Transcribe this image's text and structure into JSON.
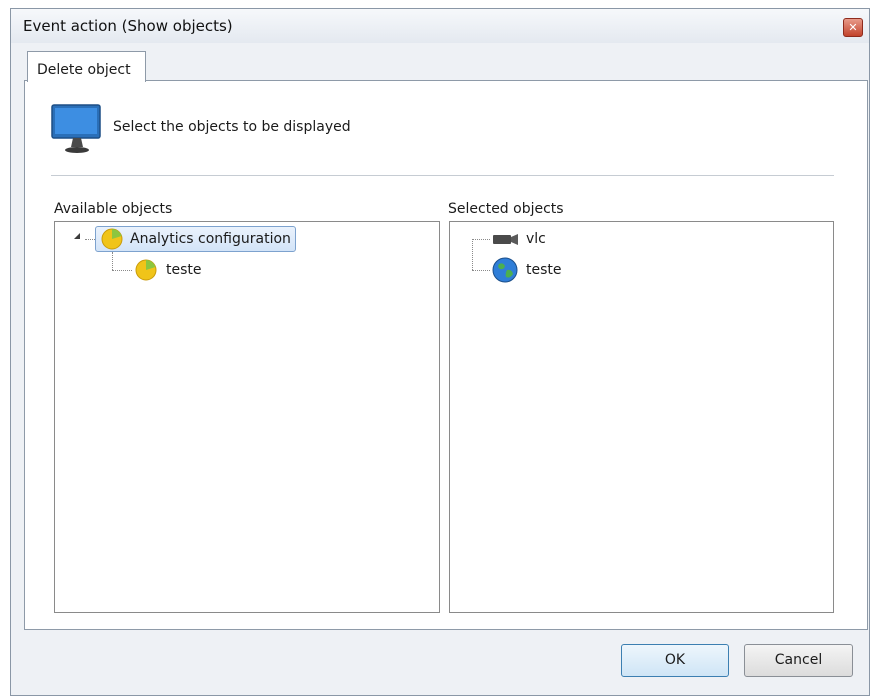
{
  "window": {
    "title": "Event action (Show objects)"
  },
  "tab": {
    "label": "Delete object"
  },
  "header": {
    "text": "Select the objects to be displayed",
    "icon": "monitor-icon"
  },
  "available": {
    "label": "Available objects",
    "nodes": [
      {
        "label": "Analytics configuration",
        "icon": "pie-chart-icon",
        "expanded": true,
        "selected": true
      },
      {
        "label": "teste",
        "icon": "pie-chart-icon"
      }
    ]
  },
  "selected": {
    "label": "Selected objects",
    "nodes": [
      {
        "label": "vlc",
        "icon": "camera-icon"
      },
      {
        "label": "teste",
        "icon": "globe-icon"
      }
    ]
  },
  "buttons": {
    "ok": "OK",
    "cancel": "Cancel"
  },
  "colors": {
    "selection_border": "#7da2ce",
    "default_button_border": "#3c7fb1"
  }
}
